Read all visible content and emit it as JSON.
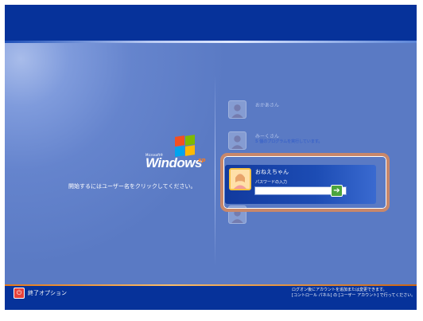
{
  "logo": {
    "microsoft": "Microsoft®",
    "windows": "Windows",
    "xp": "xp"
  },
  "instruction": "開始するにはユーザー名をクリックしてください。",
  "users": [
    {
      "name": "おかあさん",
      "status": ""
    },
    {
      "name": "みーくさん",
      "status": "5 個のプログラムを実行しています。"
    },
    {
      "name": "",
      "status": ""
    }
  ],
  "selected_user": {
    "name": "おねえちゃん",
    "password_label": "パスワードの入力",
    "password_value": "",
    "go_icon": "arrow-right-icon"
  },
  "footer": {
    "shutdown_label": "終了オプション",
    "help_line1": "ログオン後にアカウントを追加または変更できます。",
    "help_line2": "[コントロール パネル] の [ユーザー アカウント] で行ってください。"
  },
  "colors": {
    "topbar": "#06329a",
    "background": "#5a7cc5",
    "highlight": "#c8876a",
    "accent_orange": "#e2781b"
  }
}
